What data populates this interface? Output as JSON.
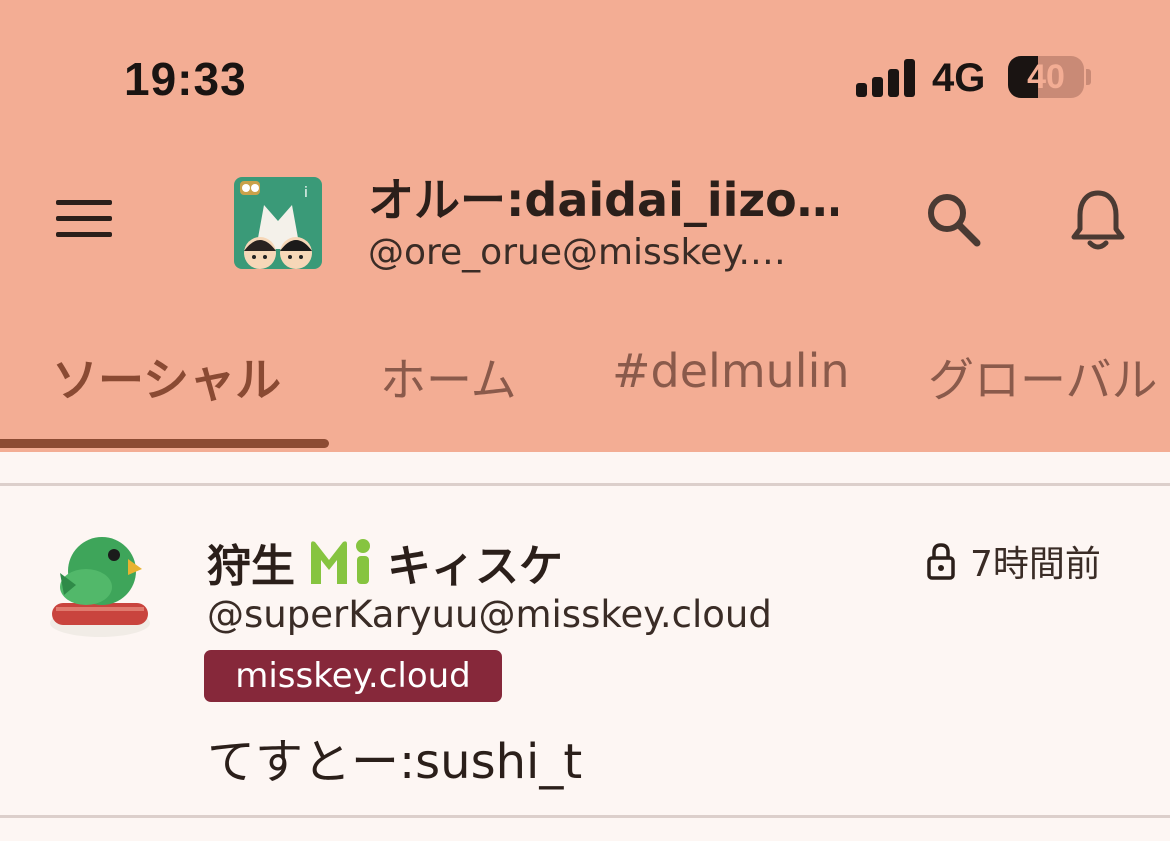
{
  "status_bar": {
    "time": "19:33",
    "network": "4G",
    "battery_level": "40",
    "signal_bars": 4
  },
  "header": {
    "menu_icon": "hamburger-menu-icon",
    "account_name": "オルー:daidai_iizo…",
    "account_handle": "@ore_orue@misskey.…",
    "search_icon": "search-icon",
    "notification_icon": "bell-icon"
  },
  "tabs": [
    {
      "label": "ソーシャル",
      "active": true
    },
    {
      "label": "ホーム",
      "active": false
    },
    {
      "label": "#delmulin",
      "active": false
    },
    {
      "label": "グローバル",
      "active": false
    }
  ],
  "note": {
    "author_name_prefix": "狩生",
    "author_emoji": "misskey-mi-logo",
    "author_name_suffix": "キィスケ",
    "visibility_icon": "lock-icon",
    "time_ago": "7時間前",
    "handle": "@superKaryuu@misskey.cloud",
    "instance": "misskey.cloud",
    "text": "てすとー:sushi_t"
  },
  "colors": {
    "header_bg": "#f3ad94",
    "content_bg": "#fdf6f3",
    "accent": "#8c4b33",
    "instance_badge": "#86283a",
    "mi_logo": "#86c440"
  }
}
